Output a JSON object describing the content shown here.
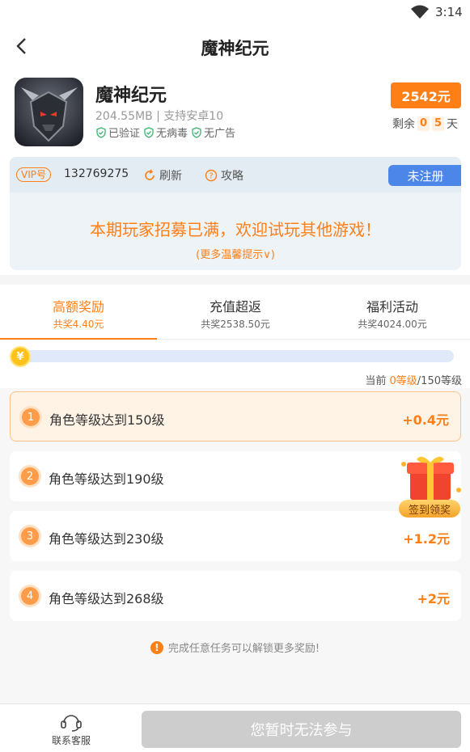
{
  "status_bar": {
    "time": "3:14"
  },
  "header": {
    "title": "魔神纪元"
  },
  "game": {
    "name": "魔神纪元",
    "meta": "204.55MB | 支持安卓10",
    "badges": [
      "已验证",
      "无病毒",
      "无广告"
    ],
    "price": "2542元",
    "remain_prefix": "剩余",
    "remain_digits": [
      "0",
      "5"
    ],
    "remain_suffix": "天"
  },
  "vip": {
    "tag": "VIP号",
    "id": "132769275",
    "refresh_label": "刷新",
    "guide_label": "攻略",
    "status_label": "未注册",
    "full_message": "本期玩家招募已满，欢迎试玩其他游戏！",
    "more_tips": "(更多温馨提示∨)"
  },
  "tabs": [
    {
      "title": "高额奖励",
      "subtitle": "共奖4.40元",
      "active": true
    },
    {
      "title": "充值超返",
      "subtitle": "共奖2538.50元",
      "active": false
    },
    {
      "title": "福利活动",
      "subtitle": "共奖4024.00元",
      "active": false
    }
  ],
  "progress": {
    "coin_symbol": "¥",
    "value": 0,
    "label_prefix": "当前 ",
    "current": "0等级",
    "total": "/150等级"
  },
  "tasks": [
    {
      "num": "1",
      "label": "角色等级达到150级",
      "reward": "+0.4元",
      "active": true
    },
    {
      "num": "2",
      "label": "角色等级达到190级",
      "reward": "",
      "active": false
    },
    {
      "num": "3",
      "label": "角色等级达到230级",
      "reward": "+1.2元",
      "active": false
    },
    {
      "num": "4",
      "label": "角色等级达到268级",
      "reward": "+2元",
      "active": false
    }
  ],
  "gift_label": "签到领奖",
  "unlock_tip": "完成任意任务可以解锁更多奖励!",
  "bottom": {
    "support_label": "联系客服",
    "join_label": "您暂时无法参与"
  },
  "colors": {
    "accent": "#ff7f17",
    "blue": "#4c86e8",
    "disabled": "#cdcdcd"
  }
}
